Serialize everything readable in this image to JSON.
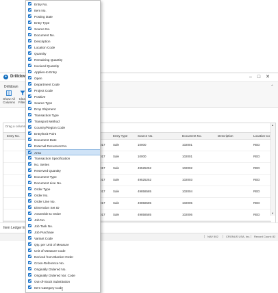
{
  "window": {
    "title": "Drilldow",
    "ribbon_tab": "Drilldown",
    "buttons": [
      {
        "label": "Show All Columns",
        "icon": "show-columns-icon"
      },
      {
        "label": "Clear Filters",
        "icon": "clear-filter-icon"
      }
    ],
    "drag_hint": "Drag a column",
    "footer_title": "Item Ledger E",
    "status": [
      "NAV 502",
      "CRONUS USA, Inc.",
      "Record Count:  82"
    ]
  },
  "grid": {
    "headers": [
      "Entry No.",
      "Entry Type",
      "Source No.",
      "Document No.",
      "Description",
      "Location Co"
    ],
    "rows": [
      {
        "date": "017",
        "type": "Sale",
        "source": "10000",
        "doc": "102001",
        "desc": "",
        "loc": "RED"
      },
      {
        "date": "017",
        "type": "Sale",
        "source": "10000",
        "doc": "102001",
        "desc": "",
        "loc": "RED"
      },
      {
        "date": "017",
        "type": "Sale",
        "source": "49525252",
        "doc": "102002",
        "desc": "",
        "loc": "RED"
      },
      {
        "date": "017",
        "type": "Sale",
        "source": "49525252",
        "doc": "102003",
        "desc": "",
        "loc": "RED"
      },
      {
        "date": "017",
        "type": "Sale",
        "source": "49858585",
        "doc": "102004",
        "desc": "",
        "loc": "RED"
      },
      {
        "date": "017",
        "type": "Sale",
        "source": "49858585",
        "doc": "102005",
        "desc": "",
        "loc": "RED"
      },
      {
        "date": "017",
        "type": "Sale",
        "source": "49858585",
        "doc": "102006",
        "desc": "",
        "loc": "RED"
      }
    ]
  },
  "menu": {
    "selected_index": 24,
    "items": [
      "Entry No.",
      "Item No.",
      "Posting Date",
      "Entry Type",
      "Source No.",
      "Document No.",
      "Description",
      "Location Code",
      "Quantity",
      "Remaining Quantity",
      "Invoiced Quantity",
      "Applies-to Entry",
      "Open",
      "Department Code",
      "Project Code",
      "Positive",
      "Source Type",
      "Drop Shipment",
      "Transaction Type",
      "Transport Method",
      "Country/Region Code",
      "Entry/Exit Point",
      "Document Date",
      "External Document No.",
      "Area",
      "Transaction Specification",
      "No. Series",
      "Reserved Quantity",
      "Document Type",
      "Document Line No.",
      "Order Type",
      "Order No.",
      "Order Line No.",
      "Dimension Set ID",
      "Assemble to Order",
      "Job No.",
      "Job Task No.",
      "Job Purchase",
      "Variant Code",
      "Qty. per Unit of Measure",
      "Unit of Measure Code",
      "Derived from Blanket Order",
      "Cross-Reference No.",
      "Originally Ordered No.",
      "Originally Ordered Var. Code",
      "Out-of-Stock Substitution",
      "Item Category Code"
    ],
    "more_indicator": "▾"
  }
}
